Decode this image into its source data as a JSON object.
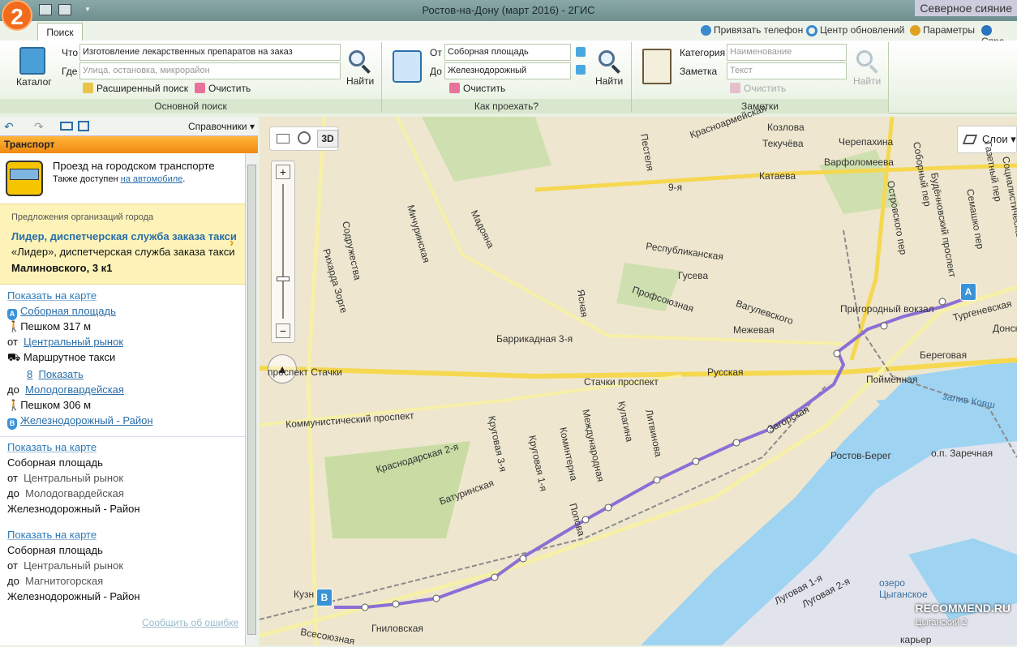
{
  "window": {
    "title": "Ростов-на-Дону (март 2016) - 2ГИС",
    "notification": "Северное сияние",
    "logo": "2",
    "quick_access": [
      "folder-icon",
      "print-icon",
      "dropdown-icon"
    ]
  },
  "tabs": [
    {
      "label": "Поиск",
      "active": true
    }
  ],
  "top_right": {
    "bind_phone": "Привязать телефон",
    "update_center": "Центр обновлений",
    "params": "Параметры",
    "help": "Спра"
  },
  "ribbon": {
    "main_search": {
      "catalog_label": "Каталог",
      "what_label": "Что",
      "what_value": "Изготовление лекарственных препаратов на заказ",
      "where_label": "Где",
      "where_placeholder": "Улица, остановка, микрорайон",
      "find_label": "Найти",
      "advanced_label": "Расширенный поиск",
      "clear_label": "Очистить",
      "group_label": "Основной поиск"
    },
    "route": {
      "from_label": "От",
      "from_value": "Соборная площадь",
      "to_label": "До",
      "to_value": "Железнодорожный",
      "find_label": "Найти",
      "clear_label": "Очистить",
      "group_label": "Как проехать?"
    },
    "notes": {
      "category_label": "Категория",
      "category_placeholder": "Наименование",
      "note_label": "Заметка",
      "note_placeholder": "Текст",
      "find_label": "Найти",
      "clear_label": "Очистить",
      "group_label": "Заметки"
    }
  },
  "left_panel": {
    "directories_label": "Справочники",
    "header": "Транспорт",
    "transport": {
      "title": "Проезд на городском транспорте",
      "also_prefix": "Также доступен",
      "also_link": "на автомобиле",
      "also_suffix": "."
    },
    "promo": {
      "caption": "Предложения организаций города",
      "title": "Лидер, диспетчерская служба заказа такси",
      "line2": "«Лидер», диспетчерская служба заказа такси",
      "address": "Малиновского, 3 к1"
    },
    "route1": {
      "show_on_map": "Показать на карте",
      "start_pin": "A",
      "start": "Соборная площадь",
      "walk1": "Пешком 317 м",
      "from_label": "от",
      "from_stop": "Центральный рынок",
      "mode": "Маршрутное такси",
      "count": "8",
      "show_link": "Показать",
      "to_label": "до",
      "to_stop": "Молодогвардейская",
      "walk2": "Пешком 306 м",
      "end_pin": "B",
      "end": "Железнодорожный - Район"
    },
    "route2": {
      "show_on_map": "Показать на карте",
      "start": "Соборная площадь",
      "from_label": "от",
      "from_stop": "Центральный рынок",
      "to_label": "до",
      "to_stop": "Молодогвардейская",
      "end": "Железнодорожный - Район"
    },
    "route3": {
      "show_on_map": "Показать на карте",
      "start": "Соборная площадь",
      "from_label": "от",
      "from_stop": "Центральный рынок",
      "to_label": "до",
      "to_stop": "Магнитогорская",
      "end": "Железнодорожный - Район"
    },
    "report_error": "Сообщить об ошибке"
  },
  "map": {
    "mode_3d": "3D",
    "layers": "Слои",
    "pin_a": "A",
    "pin_b": "B",
    "watermark": "RECOMMEND.RU",
    "watermark2": "Цыганский 2",
    "streets": {
      "krasnoarm": "Красноармейская",
      "kozlova": "Козлова",
      "tekucheva": "Текучёва",
      "cherepakhina": "Черепахина",
      "varfolomeeva": "Варфоломеева",
      "kataeva": "Катаева",
      "pestelya": "Пестеля",
      "nine": "9-я",
      "sobornyi": "Соборный пер",
      "budennov": "Будённовский проспект",
      "ostrovskogo": "Островского пер",
      "semashko": "Семашко пер",
      "gazetnyi": "Газетный пер",
      "socialist": "Социалистическая",
      "mitch": "Мичуринская",
      "madoyana": "Мадояна",
      "sodruzh": "Содружества",
      "sorge": "Рихарда Зорге",
      "respub": "Республиканская",
      "guseva": "Гусева",
      "profsoyuz": "Профсоюзная",
      "vagulev": "Вагулевского",
      "mezheva": "Межевая",
      "yasnaya": "Ясная",
      "barrik": "Баррикадная 3-я",
      "prigorod": "Пригородный вокзал",
      "turgenev": "Тургеневская",
      "donskaya": "Донск",
      "beregovaya": "Береговая",
      "poimennaya": "Поймённая",
      "zaliv": "залив Ковш",
      "stachki_left": "проспект Стачки",
      "stachki": "Стачки проспект",
      "russkaya": "Русская",
      "kommun": "Коммунистический проспект",
      "krugovaya3": "Круговая 3-я",
      "krugovaya1": "Круговая 1-я",
      "kominterna": "Коминтерна",
      "mezhdunar": "Международная",
      "kulagina": "Кулагина",
      "litvinova": "Литвинова",
      "zagorskaya": "Загорская",
      "krasnodar2": "Краснодарская 2-я",
      "baturin": "Батуринская",
      "popova": "Попова",
      "rostov_bereg": "Ростов-Берег",
      "zarechnaya": "о.п. Заречная",
      "lugovaya1": "Луговая 1-я",
      "lugovaya2": "Луговая 2-я",
      "ozero": "озеро Цыганское",
      "kuzn": "Кузн",
      "vseso": "Всесоюзная",
      "gnilov": "Гниловская",
      "karer": "карьер"
    }
  }
}
